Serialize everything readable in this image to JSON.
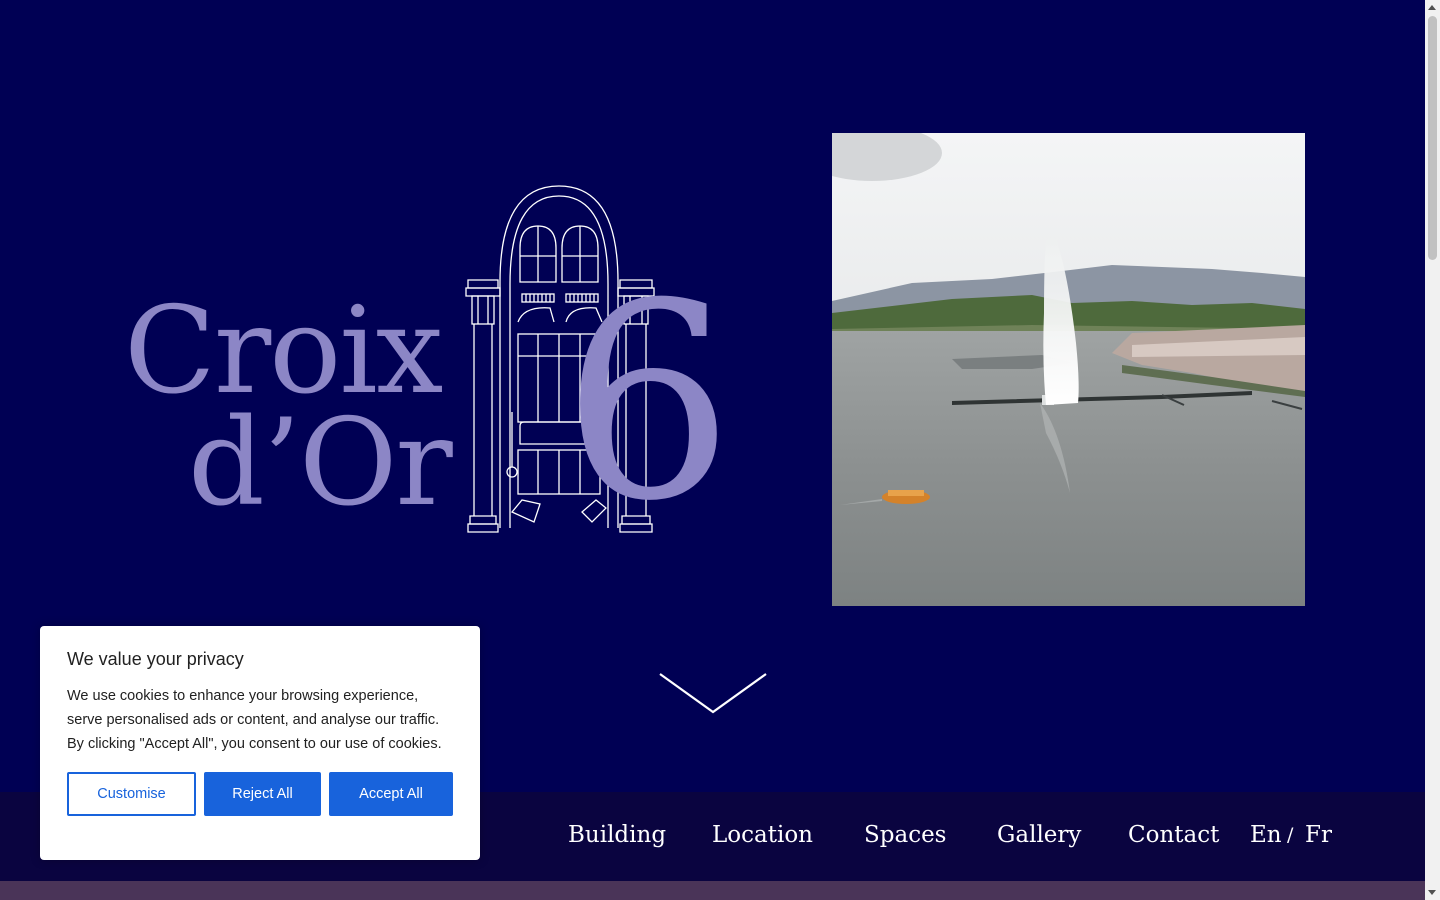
{
  "logo": {
    "line1": "Croix",
    "line2": "d’Or",
    "numeral": "6"
  },
  "nav": {
    "items": [
      "Building",
      "Location",
      "Spaces",
      "Gallery",
      "Contact"
    ],
    "lang_en": "En",
    "lang_sep": "/",
    "lang_fr": "Fr"
  },
  "cookie": {
    "title": "We value your privacy",
    "body": "We use cookies to enhance your browsing experience, serve personalised ads or content, and analyse our traffic. By clicking \"Accept All\", you consent to our use of cookies.",
    "customise": "Customise",
    "reject": "Reject All",
    "accept": "Accept All"
  },
  "colors": {
    "background": "#000054",
    "logo": "#8c86c6",
    "navbar": "#0a0440",
    "accent_blue": "#1863dc"
  }
}
